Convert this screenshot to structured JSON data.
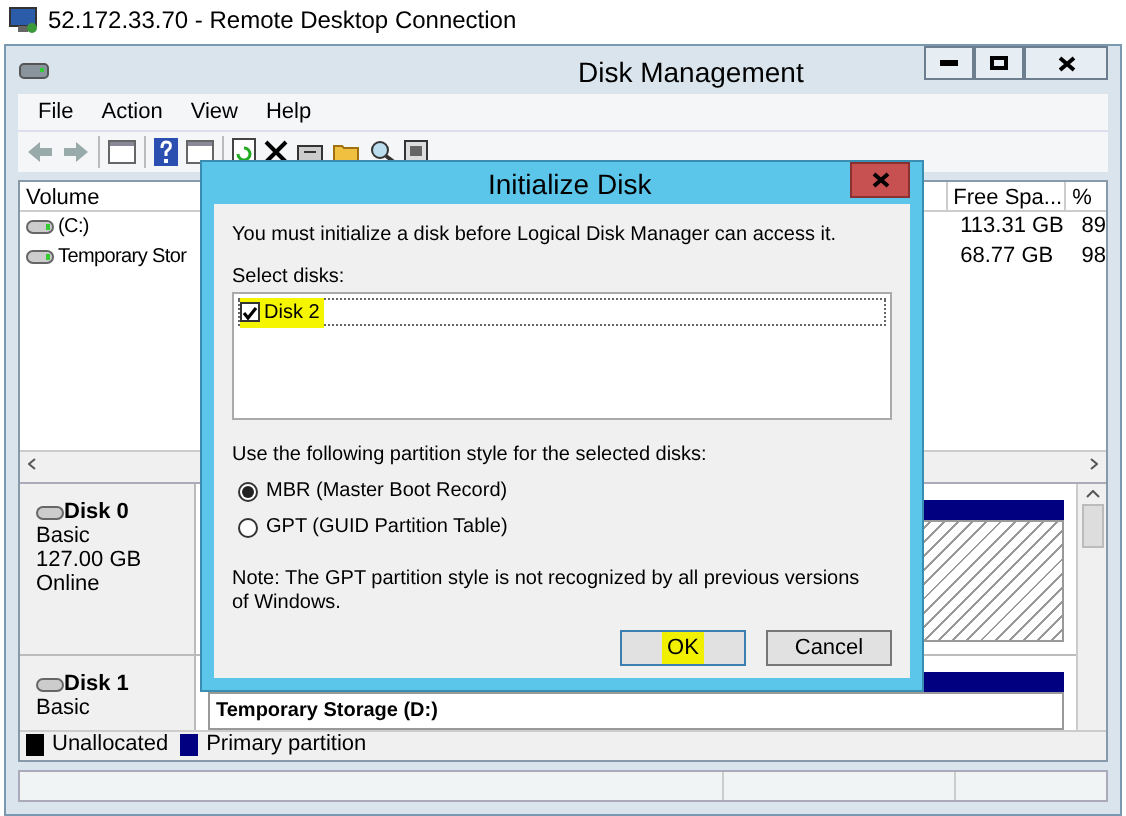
{
  "rdp_window": {
    "title": "52.172.33.70 - Remote Desktop Connection"
  },
  "window": {
    "title": "Disk Management"
  },
  "menu": [
    "File",
    "Action",
    "View",
    "Help"
  ],
  "volume_list": {
    "columns": [
      {
        "label": "Volume"
      },
      {
        "label": "Free Spa..."
      },
      {
        "label": "%"
      }
    ],
    "rows": [
      {
        "volume": "(C:)",
        "free_space": "113.31 GB",
        "percent_free": "89"
      },
      {
        "volume": "Temporary Stor",
        "free_space": "68.77 GB",
        "percent_free": "98"
      }
    ]
  },
  "disks": [
    {
      "name": "Disk 0",
      "lines": [
        "Basic",
        "127.00 GB",
        "Online"
      ]
    },
    {
      "name": "Disk 1",
      "lines": [
        "Basic"
      ],
      "partition": "Temporary Storage  (D:)"
    }
  ],
  "legend": [
    {
      "label": "Unallocated",
      "color": "#000000"
    },
    {
      "label": "Primary partition",
      "color": "#000080"
    }
  ],
  "dialog": {
    "title": "Initialize Disk",
    "message": "You must initialize a disk before Logical Disk Manager can access it.",
    "select_label": "Select disks:",
    "disks": [
      {
        "label": "Disk 2",
        "checked": true,
        "highlighted": true
      }
    ],
    "style_label": "Use the following partition style for the selected disks:",
    "options": [
      {
        "label": "MBR (Master Boot Record)",
        "selected": true
      },
      {
        "label": "GPT (GUID Partition Table)",
        "selected": false
      }
    ],
    "note": "Note: The GPT partition style is not recognized by all previous versions of Windows.",
    "buttons": [
      {
        "label": "OK",
        "default": true,
        "highlighted": true
      },
      {
        "label": "Cancel",
        "default": false,
        "highlighted": false
      }
    ]
  }
}
